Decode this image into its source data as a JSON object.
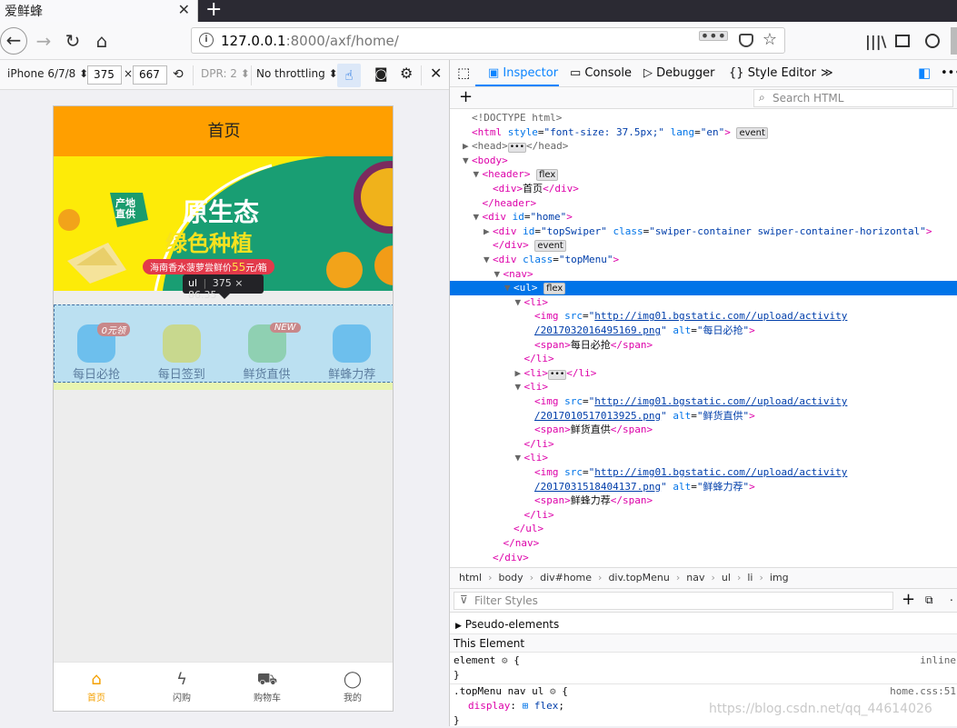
{
  "browser": {
    "tab_title": "爱鲜蜂",
    "tab_close": "✕",
    "new_tab": "+",
    "url_host": "127.0.0.1",
    "url_rest": ":8000/axf/home/",
    "page_actions": "•••"
  },
  "rdm": {
    "device": "iPhone 6/7/8 ⬍",
    "width": "375",
    "times": "×",
    "height": "667",
    "dpr": "DPR: 2 ⬍",
    "throttle": "No throttling ⬍"
  },
  "phone": {
    "header_title": "首页",
    "banner": {
      "badge_line1": "产地",
      "badge_line2": "直供",
      "headline1": "原生态",
      "headline2": "绿色种植",
      "promo_prefix": "海南香水菠萝尝鲜价",
      "promo_price": "55",
      "promo_suffix": "元/箱"
    },
    "menu": [
      {
        "label": "每日必抢",
        "badge": "0元领",
        "color": "#6dbfed"
      },
      {
        "label": "每日签到",
        "badge": "",
        "color": "#c8d88e"
      },
      {
        "label": "鲜货直供",
        "badge": "NEW",
        "color": "#8fd0b2"
      },
      {
        "label": "鲜蜂力荐",
        "badge": "",
        "color": "#6dbfed"
      }
    ],
    "tabbar": [
      {
        "label": "首页",
        "icon": "home-icon"
      },
      {
        "label": "闪购",
        "icon": "flash-icon"
      },
      {
        "label": "购物车",
        "icon": "cart-icon"
      },
      {
        "label": "我的",
        "icon": "user-icon"
      }
    ]
  },
  "tooltip": {
    "tag": "ul",
    "size": "375 × 86.35"
  },
  "devtools": {
    "tabs": [
      "Inspector",
      "Console",
      "Debugger",
      "Style Editor"
    ],
    "search_placeholder": "Search HTML",
    "tree": [
      {
        "i": 0,
        "html": "<span class='cmt'>&lt;!DOCTYPE html&gt;</span>"
      },
      {
        "i": 0,
        "html": "<span class='tag'>&lt;html</span> <span class='attr'>style</span>=<span class='av'>\"font-size: 37.5px;\"</span> <span class='attr'>lang</span>=<span class='av'>\"en\"</span><span class='tag'>&gt;</span> <span class='bd'>event</span>"
      },
      {
        "i": 0,
        "tw": "▶",
        "html": "<span class='cmt'>&lt;head&gt;</span><span class='dots'>•••</span><span class='cmt'>&lt;/head&gt;</span>"
      },
      {
        "i": 0,
        "tw": "▼",
        "html": "<span class='tag'>&lt;body&gt;</span>"
      },
      {
        "i": 1,
        "tw": "▼",
        "html": "<span class='tag'>&lt;header&gt;</span> <span class='bd'>flex</span>"
      },
      {
        "i": 2,
        "html": "<span class='tag'>&lt;div&gt;</span>首页<span class='tag'>&lt;/div&gt;</span>"
      },
      {
        "i": 1,
        "html": "<span class='tag'>&lt;/header&gt;</span>"
      },
      {
        "i": 1,
        "tw": "▼",
        "html": "<span class='tag'>&lt;div</span> <span class='attr'>id</span>=<span class='av'>\"home\"</span><span class='tag'>&gt;</span>"
      },
      {
        "i": 2,
        "tw": "▶",
        "html": "<span class='tag'>&lt;div</span> <span class='attr'>id</span>=<span class='av'>\"topSwiper\"</span> <span class='attr'>class</span>=<span class='av'>\"swiper-container swiper-container-horizontal\"</span><span class='tag'>&gt;</span>"
      },
      {
        "i": 2,
        "html": "<span class='tag'>&lt;/div&gt;</span> <span class='bd'>event</span>"
      },
      {
        "i": 2,
        "tw": "▼",
        "html": "<span class='tag'>&lt;div</span> <span class='attr'>class</span>=<span class='av'>\"topMenu\"</span><span class='tag'>&gt;</span>"
      },
      {
        "i": 3,
        "tw": "▼",
        "html": "<span class='tag'>&lt;nav&gt;</span>"
      },
      {
        "i": 4,
        "tw": "▼",
        "hl": true,
        "html": "<span class='tag'>&lt;ul&gt;</span> <span class='bd'>flex</span>"
      },
      {
        "i": 5,
        "tw": "▼",
        "html": "<span class='tag'>&lt;li&gt;</span>"
      },
      {
        "i": 6,
        "html": "<span class='tag'>&lt;img</span> <span class='attr'>src</span>=<span class='av'>\"</span><span class='link'>http://img01.bgstatic.com//upload/activity</span>"
      },
      {
        "i": 6,
        "html": "<span class='link'>/2017032016495169.png</span><span class='av'>\"</span> <span class='attr'>alt</span>=<span class='av'>\"每日必抢\"</span><span class='tag'>&gt;</span>"
      },
      {
        "i": 6,
        "html": "<span class='tag'>&lt;span&gt;</span>每日必抢<span class='tag'>&lt;/span&gt;</span>"
      },
      {
        "i": 5,
        "html": "<span class='tag'>&lt;/li&gt;</span>"
      },
      {
        "i": 5,
        "tw": "▶",
        "html": "<span class='tag'>&lt;li&gt;</span><span class='dots'>•••</span><span class='tag'>&lt;/li&gt;</span>"
      },
      {
        "i": 5,
        "tw": "▼",
        "html": "<span class='tag'>&lt;li&gt;</span>"
      },
      {
        "i": 6,
        "html": "<span class='tag'>&lt;img</span> <span class='attr'>src</span>=<span class='av'>\"</span><span class='link'>http://img01.bgstatic.com//upload/activity</span>"
      },
      {
        "i": 6,
        "html": "<span class='link'>/2017010517013925.png</span><span class='av'>\"</span> <span class='attr'>alt</span>=<span class='av'>\"鲜货直供\"</span><span class='tag'>&gt;</span>"
      },
      {
        "i": 6,
        "html": "<span class='tag'>&lt;span&gt;</span>鲜货直供<span class='tag'>&lt;/span&gt;</span>"
      },
      {
        "i": 5,
        "html": "<span class='tag'>&lt;/li&gt;</span>"
      },
      {
        "i": 5,
        "tw": "▼",
        "html": "<span class='tag'>&lt;li&gt;</span>"
      },
      {
        "i": 6,
        "html": "<span class='tag'>&lt;img</span> <span class='attr'>src</span>=<span class='av'>\"</span><span class='link'>http://img01.bgstatic.com//upload/activity</span>"
      },
      {
        "i": 6,
        "html": "<span class='link'>/2017031518404137.png</span><span class='av'>\"</span> <span class='attr'>alt</span>=<span class='av'>\"鲜蜂力荐\"</span><span class='tag'>&gt;</span>"
      },
      {
        "i": 6,
        "html": "<span class='tag'>&lt;span&gt;</span>鲜蜂力荐<span class='tag'>&lt;/span&gt;</span>"
      },
      {
        "i": 5,
        "html": "<span class='tag'>&lt;/li&gt;</span>"
      },
      {
        "i": 4,
        "html": "<span class='tag'>&lt;/ul&gt;</span>"
      },
      {
        "i": 3,
        "html": "<span class='tag'>&lt;/nav&gt;</span>"
      },
      {
        "i": 2,
        "html": "<span class='tag'>&lt;/div&gt;</span>"
      }
    ],
    "breadcrumbs": [
      "html",
      "body",
      "div#home",
      "div.topMenu",
      "nav",
      "ul",
      "li",
      "img"
    ],
    "filter_placeholder": "Filter Styles",
    "pseudo_elements": "Pseudo-elements",
    "this_element": "This Element",
    "rule1_selector": "element",
    "rule1_origin": "inline",
    "rule2_selector": ".topMenu nav ul",
    "rule2_origin": "home.css:51",
    "rule2_prop": "display",
    "rule2_value": "flex",
    "watermark": "https://blog.csdn.net/qq_44614026"
  }
}
